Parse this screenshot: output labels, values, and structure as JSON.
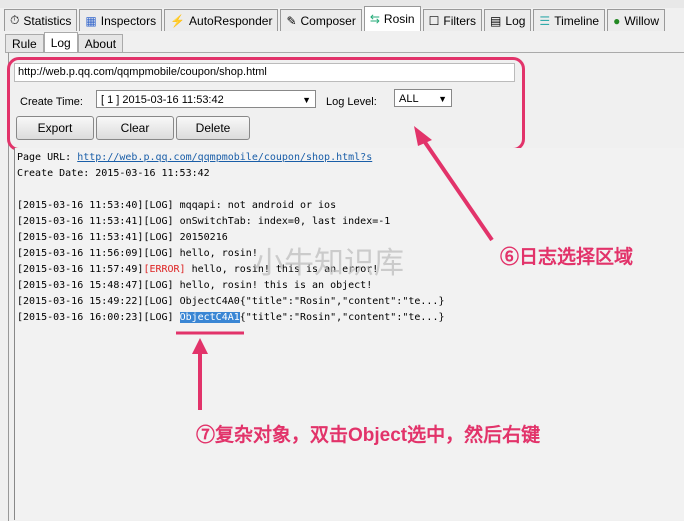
{
  "tabs": [
    {
      "label": "Statistics",
      "icon": "stopwatch-icon"
    },
    {
      "label": "Inspectors",
      "icon": "inspectors-icon"
    },
    {
      "label": "AutoResponder",
      "icon": "lightning-icon"
    },
    {
      "label": "Composer",
      "icon": "pencil-icon"
    },
    {
      "label": "Rosin",
      "icon": "arrows-icon",
      "active": true
    },
    {
      "label": "Filters",
      "icon": "checkbox-icon"
    },
    {
      "label": "Log",
      "icon": "document-icon"
    },
    {
      "label": "Timeline",
      "icon": "timeline-icon"
    },
    {
      "label": "Willow",
      "icon": "tree-icon"
    }
  ],
  "subtabs": [
    {
      "label": "Rule"
    },
    {
      "label": "Log",
      "active": true
    },
    {
      "label": "About"
    }
  ],
  "url": "http://web.p.qq.com/qqmpmobile/coupon/shop.html",
  "create_time_label": "Create Time:",
  "create_time_value": "[ 1 ] 2015-03-16 11:53:42",
  "log_level_label": "Log Level:",
  "log_level_value": "ALL",
  "buttons": {
    "export": "Export",
    "clear": "Clear",
    "delete": "Delete"
  },
  "log": {
    "page_url_label": "Page URL: ",
    "page_url": "http://web.p.qq.com/qqmpmobile/coupon/shop.html?s",
    "create_date": "Create Date: 2015-03-16 11:53:42",
    "lines": [
      {
        "ts": "[2015-03-16 11:53:40]",
        "level": "[LOG]",
        "msg": " mqqapi: not android or ios"
      },
      {
        "ts": "[2015-03-16 11:53:41]",
        "level": "[LOG]",
        "msg": " onSwitchTab: index=0, last index=-1"
      },
      {
        "ts": "[2015-03-16 11:53:41]",
        "level": "[LOG]",
        "msg": " 20150216"
      },
      {
        "ts": "[2015-03-16 11:56:09]",
        "level": "[LOG]",
        "msg": " hello, rosin!"
      },
      {
        "ts": "[2015-03-16 11:57:49]",
        "level": "[ERROR]",
        "msg": " hello, rosin! this is an error!"
      },
      {
        "ts": "[2015-03-16 15:48:47]",
        "level": "[LOG]",
        "msg": " hello, rosin! this is an object!"
      },
      {
        "ts": "[2015-03-16 15:49:22]",
        "level": "[LOG]",
        "msg": " ObjectC4A0{\"title\":\"Rosin\",\"content\":\"te...}"
      }
    ],
    "last": {
      "ts": "[2015-03-16 16:00:23]",
      "level": "[LOG] ",
      "obj": "ObjectC4A1",
      "rest": "{\"title\":\"Rosin\",\"content\":\"te...}"
    }
  },
  "annotations": {
    "a6": "⑥日志选择区域",
    "a7": "⑦复杂对象，双击Object选中，然后右键"
  },
  "watermark": "小牛知识库",
  "accent": "#e2336a"
}
